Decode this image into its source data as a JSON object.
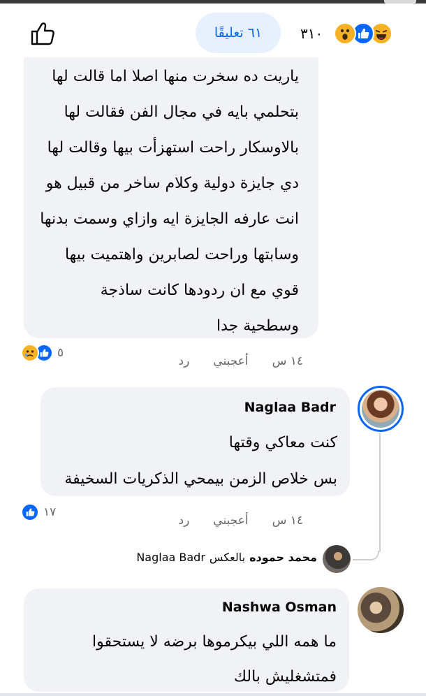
{
  "header": {
    "comments_label": "٦١ تعليقًا",
    "reaction_count": "٣١٠",
    "reaction_icons": [
      "haha-icon",
      "like-icon",
      "wow-icon"
    ]
  },
  "comments": [
    {
      "lines": [
        "ياريت ده سخرت منها اصلا اما قالت لها",
        "بتحلمي بايه في مجال الفن فقالت لها",
        "بالاوسكار راحت استهزأت بيها وقالت لها",
        "دي جايزة دولية وكلام ساخر من قبيل هو",
        "انت عارفه الجايزة ايه وازاي وسمت بدنها",
        "وسابتها وراحت لصابرين واهتميت بيها",
        "قوي مع ان ردودها كانت ساذجة",
        "وسطحية جدا"
      ],
      "time": "١٤ س",
      "like_label": "أعجبني",
      "reply_label": "رد",
      "reaction_count": "٥",
      "reaction_icons": [
        "like-icon",
        "sad-icon"
      ]
    },
    {
      "author": "Naglaa Badr",
      "lines": [
        "كنت معاكي وقتها",
        "بس خلاص الزمن بيمحي الذكريات السخيفة"
      ],
      "time": "١٤ س",
      "like_label": "أعجبني",
      "reply_label": "رد",
      "reaction_count": "١٧",
      "reaction_icons": [
        "like-icon"
      ]
    },
    {
      "author": "Nashwa Osman",
      "lines": [
        "ما همه اللي بيكرموها برضه لا يستحقوا",
        "فمتشغليش بالك"
      ]
    }
  ],
  "reply_preview": {
    "name": "محمد حموده",
    "text": "بالعكس",
    "mention": "Naglaa Badr"
  },
  "colors": {
    "accent": "#0866ff",
    "bubble": "#f0f2f5",
    "meta": "#65676b",
    "pill": "#e7f0fd"
  }
}
